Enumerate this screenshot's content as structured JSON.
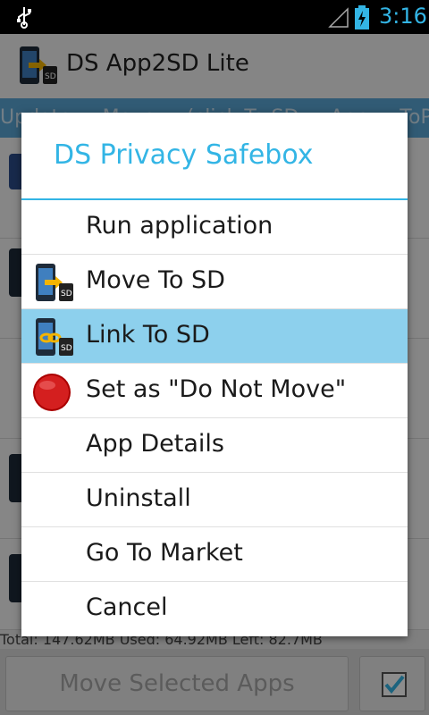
{
  "status": {
    "time": "3:16"
  },
  "app": {
    "title": "DS App2SD Lite"
  },
  "background": {
    "band_text": "Update ... Move ... (click To SD ... App ... ToPh",
    "storage_text": "Total: 147.62MB Used: 64.92MB Left: 82.7MB",
    "move_button": "Move Selected Apps"
  },
  "dialog": {
    "title": "DS Privacy Safebox",
    "items": [
      {
        "label": "Run application"
      },
      {
        "label": "Move To SD"
      },
      {
        "label": "Link To SD"
      },
      {
        "label": "Set as \"Do Not Move\""
      },
      {
        "label": "App Details"
      },
      {
        "label": "Uninstall"
      },
      {
        "label": "Go To Market"
      },
      {
        "label": "Cancel"
      }
    ],
    "selected_index": 2
  },
  "colors": {
    "accent": "#33b5e5",
    "selected": "#8dd0ed",
    "status_bg": "#000000"
  },
  "icons": [
    "usb-icon",
    "signal-icon",
    "battery-icon",
    "app-icon",
    "move-to-sd-icon",
    "link-to-sd-icon",
    "do-not-move-icon",
    "checkbox-icon"
  ]
}
